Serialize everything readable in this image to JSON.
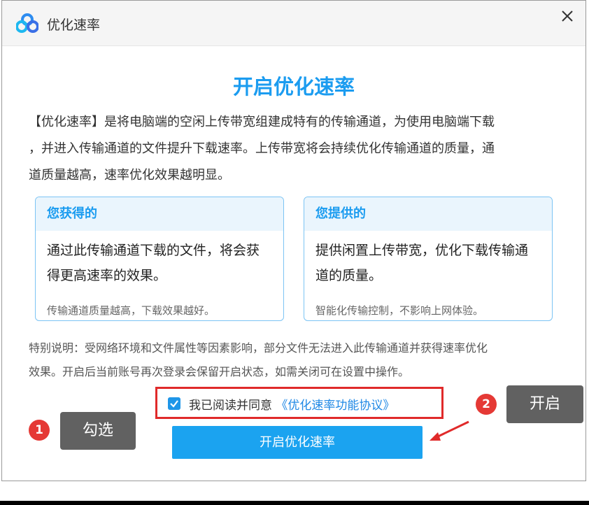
{
  "window": {
    "title": "优化速率",
    "close_label": "×"
  },
  "content": {
    "heading": "开启优化速率",
    "intro_lines": [
      "【优化速率】是将电脑端的空闲上传带宽组建成特有的传输通道，为使用电脑端下载",
      "，并进入传输通道的文件提升下载速率。上传带宽将会持续优化传输通道的质量，通",
      "道质量越高，速率优化效果越明显。"
    ],
    "cards": [
      {
        "title": "您获得的",
        "body_lines": [
          "通过此传输通道下载的文件，将会获",
          "得更高速率的效果。"
        ],
        "note": "传输通道质量越高，下载效果越好。"
      },
      {
        "title": "您提供的",
        "body_lines": [
          "提供闲置上传带宽，优化下载传输通",
          "道的质量。"
        ],
        "note": "智能化传输控制，不影响上网体验。"
      }
    ],
    "notice_lines": [
      "特别说明：受网络环境和文件属性等因素影响，部分文件无法进入此传输通道并获得速率优化",
      "效果。开启后当前账号再次登录会保留开启状态，如需关闭可在设置中操作。"
    ]
  },
  "agreement": {
    "checked": true,
    "text": "我已阅读并同意",
    "link": "《优化速率功能协议》"
  },
  "button": {
    "label": "开启优化速率"
  },
  "annotations": [
    {
      "number": "1",
      "label": "勾选"
    },
    {
      "number": "2",
      "label": "开启"
    }
  ],
  "colors": {
    "accent": "#1b9cf0",
    "highlight_border": "#e02a2a",
    "callout_bg": "#616161",
    "bubble": "#e53935"
  }
}
